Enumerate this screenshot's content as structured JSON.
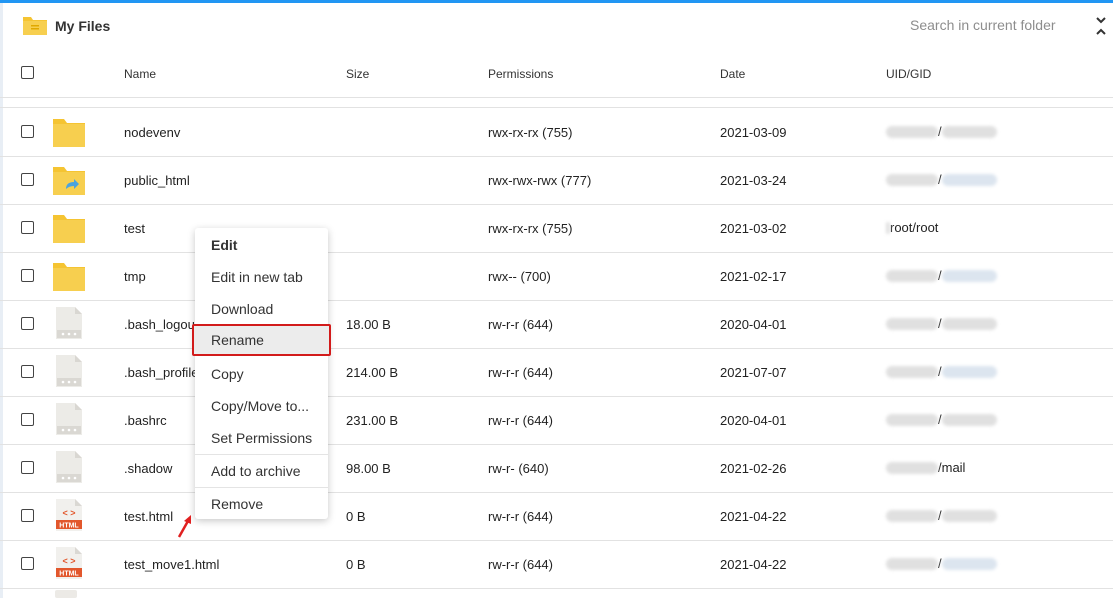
{
  "header": {
    "title": "My Files",
    "search_placeholder": "Search in current folder"
  },
  "columns": {
    "name": "Name",
    "size": "Size",
    "permissions": "Permissions",
    "date": "Date",
    "uidgid": "UID/GID"
  },
  "rows": [
    {
      "type": "folder",
      "name": "nodevenv",
      "size": "",
      "permissions": "rwx-rx-rx (755)",
      "date": "2021-03-09",
      "uid_text": "/"
    },
    {
      "type": "folder-shared",
      "name": "public_html",
      "size": "",
      "permissions": "rwx-rwx-rwx (777)",
      "date": "2021-03-24",
      "uid_text": "/"
    },
    {
      "type": "folder",
      "name": "test",
      "size": "",
      "permissions": "rwx-rx-rx (755)",
      "date": "2021-03-02",
      "uid_text": "root/root"
    },
    {
      "type": "folder",
      "name": "tmp",
      "size": "",
      "permissions": "rwx-- (700)",
      "date": "2021-02-17",
      "uid_text": "/"
    },
    {
      "type": "file",
      "name": ".bash_logout",
      "size": "18.00 B",
      "permissions": "rw-r-r (644)",
      "date": "2020-04-01",
      "uid_text": "/"
    },
    {
      "type": "file",
      "name": ".bash_profile",
      "size": "214.00 B",
      "permissions": "rw-r-r (644)",
      "date": "2021-07-07",
      "uid_text": "/"
    },
    {
      "type": "file",
      "name": ".bashrc",
      "size": "231.00 B",
      "permissions": "rw-r-r (644)",
      "date": "2020-04-01",
      "uid_text": "/"
    },
    {
      "type": "file",
      "name": ".shadow",
      "size": "98.00 B",
      "permissions": "rw-r- (640)",
      "date": "2021-02-26",
      "uid_text": "/mail"
    },
    {
      "type": "html",
      "name": "test.html",
      "size": "0 B",
      "permissions": "rw-r-r (644)",
      "date": "2021-04-22",
      "uid_text": "/"
    },
    {
      "type": "html",
      "name": "test_move1.html",
      "size": "0 B",
      "permissions": "rw-r-r (644)",
      "date": "2021-04-22",
      "uid_text": "/"
    }
  ],
  "html_icon_label": "HTML",
  "html_icon_glyph": "< >",
  "context_menu": {
    "items": [
      "Edit",
      "Edit in new tab",
      "Download",
      "Rename",
      "Copy",
      "Copy/Move to...",
      "Set Permissions",
      "Add to archive",
      "Remove"
    ],
    "highlighted": "Rename"
  },
  "colors": {
    "accent": "#2196f3",
    "folder": "#f5c432",
    "highlight_border": "#d21b1b",
    "arrow": "#e02020"
  }
}
